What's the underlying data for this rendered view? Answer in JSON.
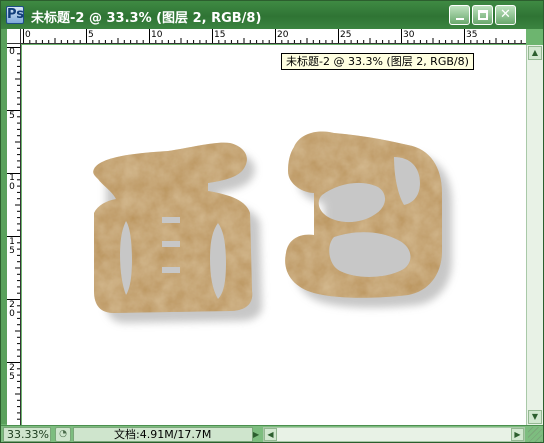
{
  "window": {
    "title": "未标题-2 @ 33.3% (图层 2, RGB/8)",
    "app_icon": "photoshop-icon",
    "buttons": {
      "minimize": "minimize-icon",
      "maximize": "maximize-icon",
      "close": "close-icon"
    }
  },
  "rulers": {
    "top_labels": [
      "0",
      "5",
      "10",
      "15",
      "20",
      "25",
      "30",
      "35"
    ],
    "left_labels": [
      "0",
      "5",
      "10",
      "15",
      "20",
      "25"
    ]
  },
  "tooltip": {
    "text": "未标题-2 @ 33.3% (图层 2, RGB/8)"
  },
  "artwork": {
    "text": "面包",
    "fill_color": "#b9935a",
    "shadow_color": "#8a8a8a"
  },
  "statusbar": {
    "zoom": "33.33%",
    "doc_info": "文档:4.91M/17.7M",
    "arrow_icon": "triangle-right-icon"
  },
  "colors": {
    "frame": "#6db56f",
    "titlebar": "#2f7434",
    "canvas": "#ffffff"
  }
}
